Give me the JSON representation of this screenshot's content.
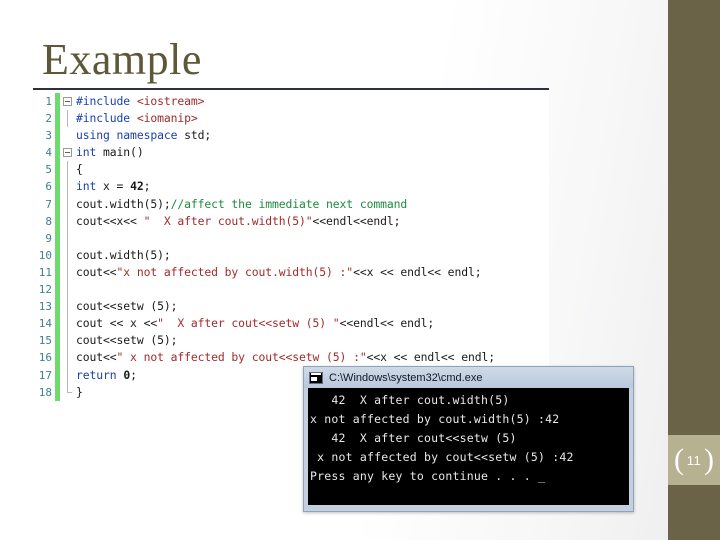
{
  "slide": {
    "title": "Example",
    "page_number": "11",
    "paren_left": "(",
    "paren_right": ")",
    "accent_color": "#6b6347",
    "page_box_color": "#b6b291",
    "title_color": "#5d5838"
  },
  "code": {
    "language": "cpp",
    "lines": [
      {
        "number": "1",
        "fold": "open",
        "tokens": [
          {
            "text": "#include ",
            "type": "pp"
          },
          {
            "text": "<iostream>",
            "type": "str"
          }
        ]
      },
      {
        "number": "2",
        "fold": "guide",
        "tokens": [
          {
            "text": "#include ",
            "type": "pp"
          },
          {
            "text": "<iomanip>",
            "type": "str"
          }
        ]
      },
      {
        "number": "3",
        "fold": "none",
        "tokens": [
          {
            "text": "using namespace ",
            "type": "kw"
          },
          {
            "text": "std;",
            "type": "plain"
          }
        ]
      },
      {
        "number": "4",
        "fold": "open",
        "tokens": [
          {
            "text": "int ",
            "type": "kw"
          },
          {
            "text": "main()",
            "type": "plain"
          }
        ]
      },
      {
        "number": "5",
        "fold": "guide",
        "tokens": [
          {
            "text": "{",
            "type": "plain"
          }
        ]
      },
      {
        "number": "6",
        "fold": "guide",
        "tokens": [
          {
            "text": "int ",
            "type": "kw"
          },
          {
            "text": "x = ",
            "type": "plain"
          },
          {
            "text": "42",
            "type": "num"
          },
          {
            "text": ";",
            "type": "plain"
          }
        ]
      },
      {
        "number": "7",
        "fold": "guide",
        "tokens": [
          {
            "text": "cout.width(5);",
            "type": "plain"
          },
          {
            "text": "//affect the immediate next command",
            "type": "com"
          }
        ]
      },
      {
        "number": "8",
        "fold": "guide",
        "tokens": [
          {
            "text": "cout<<x<< ",
            "type": "plain"
          },
          {
            "text": "\"  X after cout.width(5)\"",
            "type": "str"
          },
          {
            "text": "<<endl<<endl;",
            "type": "plain"
          }
        ]
      },
      {
        "number": "9",
        "fold": "guide",
        "tokens": []
      },
      {
        "number": "10",
        "fold": "guide",
        "tokens": [
          {
            "text": "cout.width(5);",
            "type": "plain"
          }
        ]
      },
      {
        "number": "11",
        "fold": "guide",
        "tokens": [
          {
            "text": "cout<<",
            "type": "plain"
          },
          {
            "text": "\"x not affected by cout.width(5) :\"",
            "type": "str"
          },
          {
            "text": "<<x << endl<< endl;",
            "type": "plain"
          }
        ]
      },
      {
        "number": "12",
        "fold": "guide",
        "tokens": []
      },
      {
        "number": "13",
        "fold": "guide",
        "tokens": [
          {
            "text": "cout<<setw (5);",
            "type": "plain"
          }
        ]
      },
      {
        "number": "14",
        "fold": "guide",
        "tokens": [
          {
            "text": "cout << x <<",
            "type": "plain"
          },
          {
            "text": "\"  X after cout<<setw (5) \"",
            "type": "str"
          },
          {
            "text": "<<endl<< endl;",
            "type": "plain"
          }
        ]
      },
      {
        "number": "15",
        "fold": "guide",
        "tokens": [
          {
            "text": "cout<<setw (5);",
            "type": "plain"
          }
        ]
      },
      {
        "number": "16",
        "fold": "guide",
        "tokens": [
          {
            "text": "cout<<",
            "type": "plain"
          },
          {
            "text": "\" x not affected by cout<<setw (5) :\"",
            "type": "str"
          },
          {
            "text": "<<x << endl<< endl;",
            "type": "plain"
          }
        ]
      },
      {
        "number": "17",
        "fold": "guide",
        "tokens": [
          {
            "text": "return ",
            "type": "kw"
          },
          {
            "text": "0",
            "type": "num"
          },
          {
            "text": ";",
            "type": "plain"
          }
        ]
      },
      {
        "number": "18",
        "fold": "end",
        "tokens": [
          {
            "text": "}",
            "type": "plain"
          }
        ]
      }
    ]
  },
  "console": {
    "title": "C:\\Windows\\system32\\cmd.exe",
    "icon": "console-window-icon",
    "output": [
      "   42  X after cout.width(5)",
      "x not affected by cout.width(5) :42",
      "   42  X after cout<<setw (5)",
      " x not affected by cout<<setw (5) :42",
      "Press any key to continue . . . _"
    ]
  }
}
